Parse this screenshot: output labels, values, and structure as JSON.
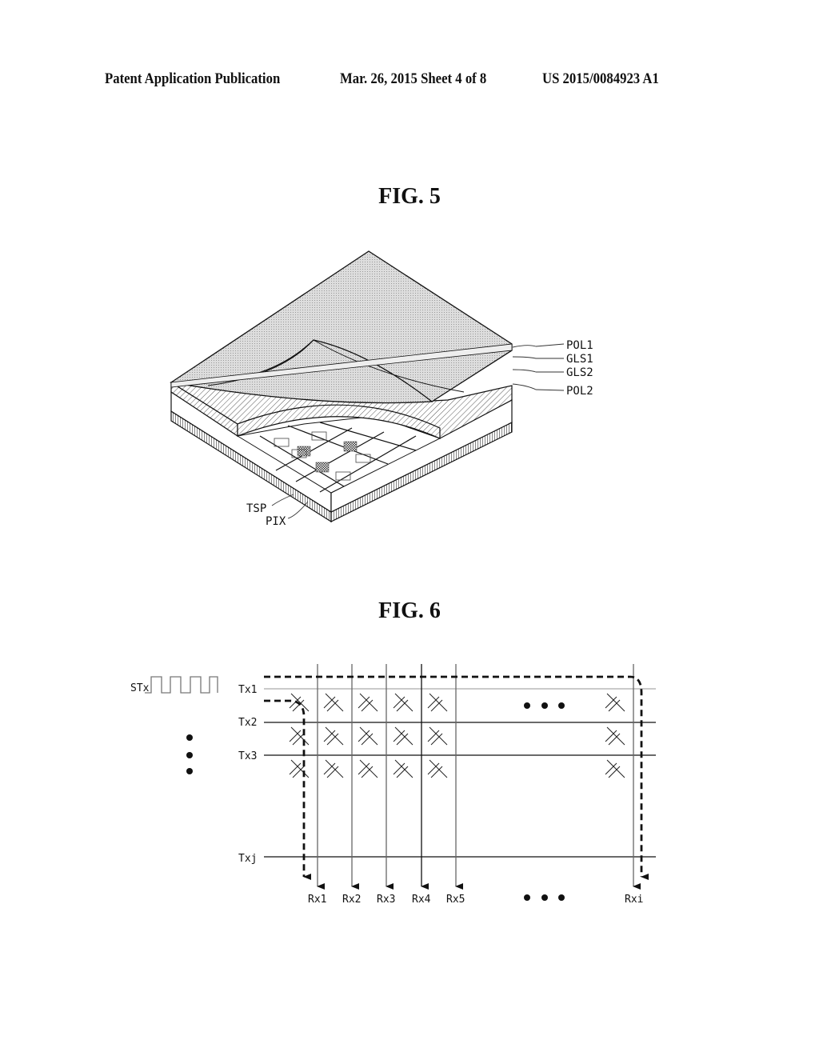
{
  "header": {
    "left": "Patent Application Publication",
    "center": "Mar. 26, 2015  Sheet 4 of 8",
    "right": "US 2015/0084923 A1"
  },
  "fig5": {
    "title": "FIG. 5",
    "layer_labels": [
      "POL1",
      "GLS1",
      "GLS2",
      "POL2"
    ],
    "inner_labels": [
      "TSP",
      "PIX"
    ]
  },
  "fig6": {
    "title": "FIG. 6",
    "signal_label": "STx",
    "tx_labels": [
      "Tx1",
      "Tx2",
      "Tx3",
      "Txj"
    ],
    "rx_labels": [
      "Rx1",
      "Rx2",
      "Rx3",
      "Rx4",
      "Rx5",
      "Rxi"
    ],
    "ellipsis": "• • •"
  }
}
